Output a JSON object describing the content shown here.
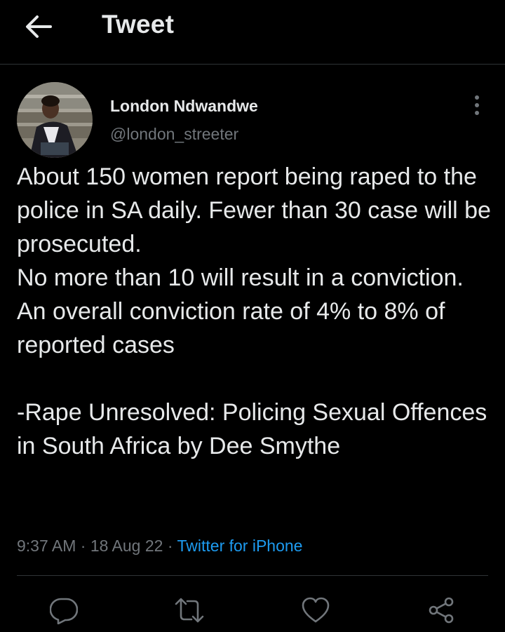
{
  "header": {
    "back_icon": "arrow-left-icon",
    "title": "Tweet"
  },
  "tweet": {
    "author": {
      "name": "London Ndwandwe",
      "handle": "@london_streeter"
    },
    "more_icon": "vertical-dots-icon",
    "text": "About 150 women report being raped to the police in SA daily. Fewer than 30 case will be prosecuted.\nNo more than 10 will result in a conviction.\nAn overall conviction rate of 4% to 8% of reported cases\n\n-Rape Unresolved: Policing Sexual Offences in South Africa by Dee Smythe",
    "time": "9:37 AM",
    "date": "18 Aug 22",
    "separator": "·",
    "source": "Twitter for iPhone"
  },
  "actions": [
    {
      "name": "reply",
      "icon": "reply-icon"
    },
    {
      "name": "retweet",
      "icon": "retweet-icon"
    },
    {
      "name": "like",
      "icon": "heart-icon"
    },
    {
      "name": "share",
      "icon": "share-icon"
    }
  ],
  "colors": {
    "background": "#000000",
    "text": "#e7e9ea",
    "secondary": "#71767b",
    "link": "#1d9bf0",
    "divider": "#2f3336"
  }
}
